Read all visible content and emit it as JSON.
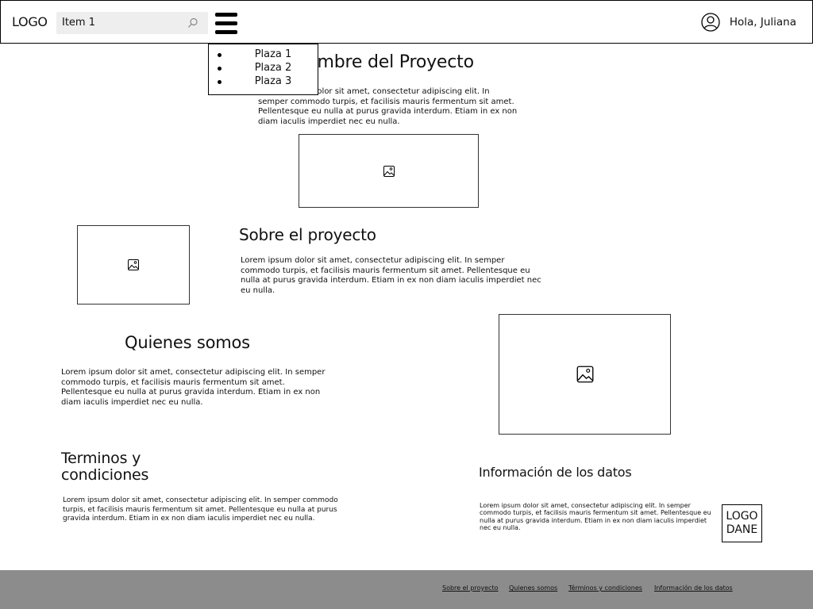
{
  "header": {
    "logo": "LOGO",
    "search_value": "Item 1",
    "greeting": "Hola, Juliana"
  },
  "menu": {
    "items": [
      {
        "label": "Plaza 1"
      },
      {
        "label": "Plaza 2"
      },
      {
        "label": "Plaza 3"
      }
    ]
  },
  "project": {
    "title": "Nombre del Proyecto",
    "text": "Lorem ipsum dolor sit amet, consectetur adipiscing elit. In semper commodo turpis, et facilisis mauris fermentum sit amet. Pellentesque eu nulla at purus gravida interdum. Etiam in ex non diam iaculis imperdiet nec eu nulla."
  },
  "about": {
    "title": "Sobre el proyecto",
    "text": "Lorem ipsum dolor sit amet, consectetur adipiscing elit. In semper commodo turpis, et facilisis mauris fermentum sit amet. Pellentesque eu nulla at purus gravida interdum. Etiam in ex non diam iaculis imperdiet nec eu nulla."
  },
  "who": {
    "title": "Quienes somos",
    "text": "Lorem ipsum dolor sit amet, consectetur adipiscing elit. In semper commodo turpis, et facilisis mauris fermentum sit amet. Pellentesque eu nulla at purus gravida interdum. Etiam in ex non diam iaculis imperdiet nec eu nulla."
  },
  "terms": {
    "title": "Terminos y condiciones",
    "text": "Lorem ipsum dolor sit amet, consectetur adipiscing elit. In semper commodo turpis, et facilisis mauris fermentum sit amet. Pellentesque eu nulla at purus gravida interdum. Etiam in ex non diam iaculis imperdiet nec eu nulla."
  },
  "data_info": {
    "title": "Información de los datos",
    "text": "Lorem ipsum dolor sit amet, consectetur adipiscing elit. In semper commodo turpis, et facilisis mauris fermentum sit amet. Pellentesque eu nulla at purus gravida interdum. Etiam in ex non diam iaculis imperdiet nec eu nulla.",
    "logo": "LOGO DANE"
  },
  "footer": {
    "links": [
      {
        "label": "Sobre el proyecto"
      },
      {
        "label": "Quienes somos"
      },
      {
        "label": "Términos y condiciones"
      },
      {
        "label": "Información de los datos"
      }
    ]
  },
  "icons": {
    "search": "search-icon",
    "menu": "hamburger-menu-icon",
    "user": "user-avatar-icon",
    "image": "image-placeholder-icon"
  }
}
